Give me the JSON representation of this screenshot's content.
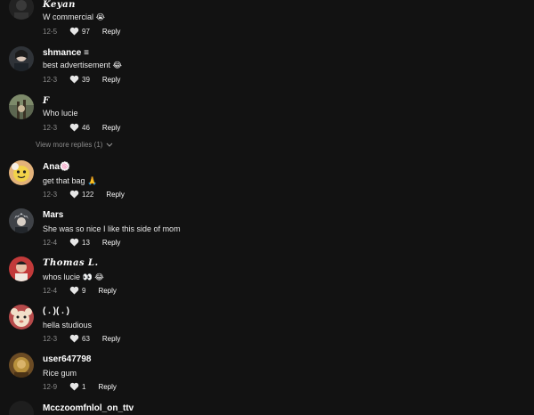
{
  "comments": [
    {
      "username": "Keyan",
      "text": "W commercial 😭",
      "date": "12-5",
      "likes": "97",
      "reply": "Reply",
      "avatar_color": "#2a2a2a"
    },
    {
      "username": "shmance ≡",
      "text": "best advertisement 😂",
      "date": "12-3",
      "likes": "39",
      "reply": "Reply",
      "avatar_color": "#3c3f45"
    },
    {
      "username": "F",
      "text": "Who lucie",
      "date": "12-3",
      "likes": "46",
      "reply": "Reply",
      "avatar_color": "#6a6f58"
    },
    {
      "username": "Ana🍥",
      "text": "get that bag 🙏",
      "date": "12-3",
      "likes": "122",
      "reply": "Reply",
      "avatar_color": "#d9a36a"
    },
    {
      "username": "Mars",
      "text": "She was so nice I like this side of mom",
      "date": "12-4",
      "likes": "13",
      "reply": "Reply",
      "avatar_color": "#4a4d52"
    },
    {
      "username": "Thomas L.",
      "text": "whos lucie 👀 😂",
      "date": "12-4",
      "likes": "9",
      "reply": "Reply",
      "avatar_color": "#b52b2b"
    },
    {
      "username": "( . )( . )",
      "text": "hella studious",
      "date": "12-3",
      "likes": "63",
      "reply": "Reply",
      "avatar_color": "#c9a7a2"
    },
    {
      "username": "user647798",
      "text": "Rice gum",
      "date": "12-9",
      "likes": "1",
      "reply": "Reply",
      "avatar_color": "#7a5a30"
    },
    {
      "username": "Mcczoomfnlol_on_ttv",
      "text": "",
      "date": "",
      "likes": "",
      "reply": "",
      "avatar_color": "#1e1e1e"
    }
  ],
  "view_more": "View more replies (1)"
}
